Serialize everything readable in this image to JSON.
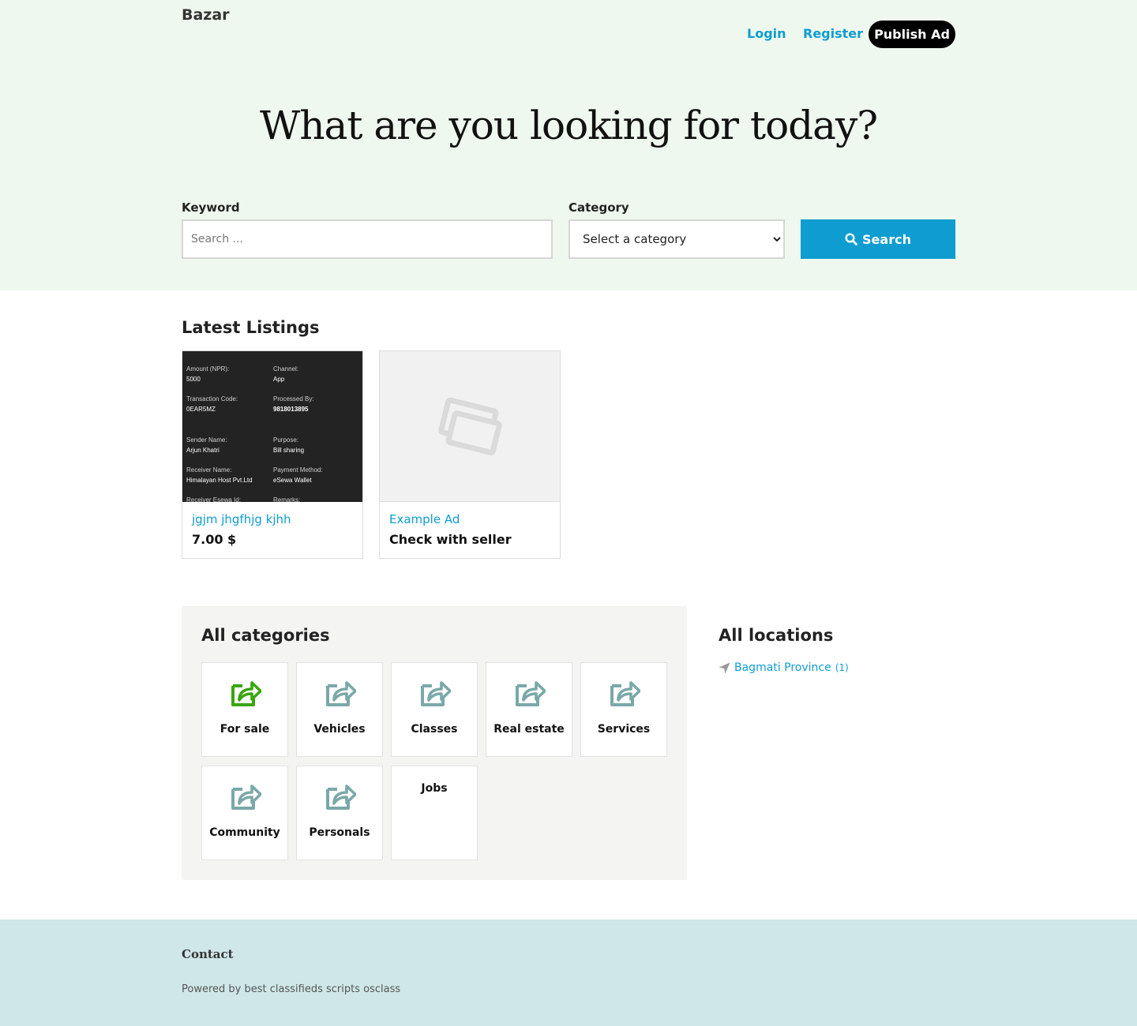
{
  "header": {
    "logo": "Bazar",
    "login_label": "Login",
    "register_label": "Register",
    "publish_label": "Publish Ad"
  },
  "hero": {
    "title": "What are you looking for today?"
  },
  "search": {
    "keyword_label": "Keyword",
    "keyword_placeholder": "Search ...",
    "category_label": "Category",
    "category_selected": "Select a category",
    "button_label": "Search"
  },
  "latest": {
    "title": "Latest Listings",
    "items": [
      {
        "title": "jgjm jhgfhjg kjhh",
        "price": "7.00 $",
        "receipt": [
          {
            "key": "Amount (NPR):",
            "value": "5000"
          },
          {
            "key": "Channel:",
            "value": "App"
          },
          {
            "key": "Transaction Code:",
            "value": "0EAR5MZ"
          },
          {
            "key": "Processed By:",
            "value": "9818013895"
          },
          {
            "key": "Sender Name:",
            "value": "Arjun Khatri"
          },
          {
            "key": "Purpose:",
            "value": "Bill sharing"
          },
          {
            "key": "Receiver Name:",
            "value": "Himalayan Host Pvt.Ltd"
          },
          {
            "key": "Payment Method:",
            "value": "eSewa Wallet"
          },
          {
            "key": "Receiver Esewa Id:",
            "value": ""
          },
          {
            "key": "Remarks:",
            "value": ""
          }
        ]
      },
      {
        "title": "Example Ad",
        "price": "Check with seller"
      }
    ]
  },
  "categories": {
    "title": "All categories",
    "items": [
      {
        "label": "For sale",
        "icon": "share-icon"
      },
      {
        "label": "Vehicles",
        "icon": "share-icon"
      },
      {
        "label": "Classes",
        "icon": "share-icon"
      },
      {
        "label": "Real estate",
        "icon": "share-icon"
      },
      {
        "label": "Services",
        "icon": "share-icon"
      },
      {
        "label": "Community",
        "icon": "share-icon"
      },
      {
        "label": "Personals",
        "icon": "share-icon"
      },
      {
        "label": "Jobs",
        "icon": ""
      }
    ],
    "colors": {
      "active_icon": "#3aa50f",
      "icon": "#7aa8a8"
    }
  },
  "locations": {
    "title": "All locations",
    "items": [
      {
        "name": "Bagmati Province",
        "count": "(1)"
      }
    ]
  },
  "footer": {
    "contact_label": "Contact",
    "powered_prefix": "Powered by",
    "powered_link": "best classifieds scripts osclass"
  },
  "colors": {
    "accent": "#0f9dd1",
    "hero_bg": "#eef8ee",
    "footer_bg": "#cfe7e7"
  }
}
